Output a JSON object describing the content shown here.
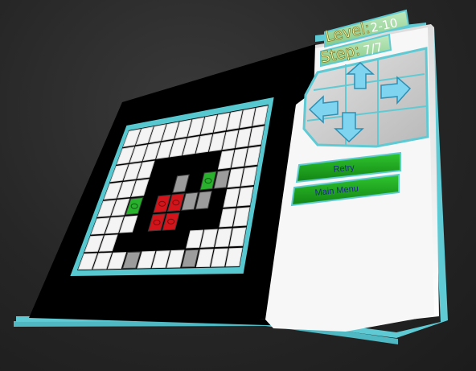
{
  "hud": {
    "level_label": "Level:",
    "level_value": "2-10",
    "step_label": "Step:",
    "step_value": "7/7"
  },
  "dpad": {
    "up": "arrow-up-icon",
    "left": "arrow-left-icon",
    "right": "arrow-right-icon",
    "down": "arrow-down-icon"
  },
  "buttons": {
    "retry": "Retry",
    "main_menu": "Main Menu"
  },
  "board": {
    "rows": [
      "WWWWWWWWWWW",
      "WWWWWWWWWWW",
      "WWW.....WWW",
      "WWW..G.CGWW",
      "WWC.RRGG.WW",
      "WWW.RR...WW",
      "WW.....WWWW",
      "WWWGWWWGWWW"
    ],
    "legend": {
      "W": "white-tile",
      "G": "gray-tile",
      ".": "empty",
      "R": "red-block",
      "C": "green-block"
    }
  },
  "colors": {
    "frame": "#57c7d0",
    "board_bg": "#000000",
    "panel": "#f2f2f2",
    "tile_white": "#f4f4f4",
    "tile_gray": "#9c9c9c",
    "block_red": "#d3141a",
    "block_green": "#29b02d",
    "button_green": "#1e9a1e",
    "button_text": "#1b2a8a",
    "hud_text": "#f7f5a8",
    "arrow": "#6bc8e8"
  }
}
